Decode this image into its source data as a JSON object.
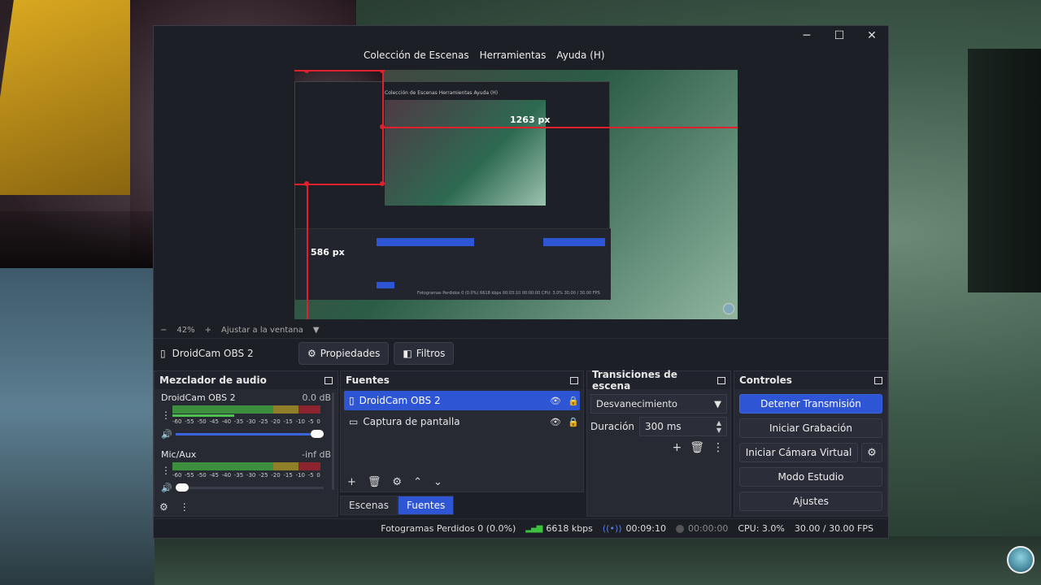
{
  "window": {
    "minimize": "─",
    "maximize": "☐",
    "close": "✕"
  },
  "menu": {
    "items": [
      "Colección de Escenas",
      "Herramientas",
      "Ayuda (H)"
    ]
  },
  "preview": {
    "measure_h": "1263 px",
    "measure_v": "586 px",
    "inner_menu": "Colección de Escenas   Herramientas   Ayuda (H)",
    "inner_status": "Fotogramas Perdidos 0 (0.0%)   6618 kbps   00:03:10   00:00:00   CPU: 3.0%   30.00 / 30.00 FPS"
  },
  "zoom": {
    "minus": "−",
    "level": "42%",
    "plus": "+",
    "fit": "Ajustar a la ventana",
    "arrow": "▼"
  },
  "source_bar": {
    "name": "DroidCam OBS 2",
    "properties": "Propiedades",
    "filters": "Filtros"
  },
  "mixer": {
    "title": "Mezclador de audio",
    "channels": [
      {
        "name": "DroidCam OBS 2",
        "db": "0.0 dB",
        "level": 0.42,
        "volume": 1.0
      },
      {
        "name": "Mic/Aux",
        "db": "-inf dB",
        "level": 0.0,
        "volume": 0.0
      }
    ],
    "ticks": [
      "-60",
      "-55",
      "-50",
      "-45",
      "-40",
      "-35",
      "-30",
      "-25",
      "-20",
      "-15",
      "-10",
      "-5",
      "0"
    ]
  },
  "sources": {
    "title": "Fuentes",
    "items": [
      {
        "name": "DroidCam OBS 2",
        "selected": true
      },
      {
        "name": "Captura de pantalla",
        "selected": false
      }
    ],
    "tabs": [
      "Escenas",
      "Fuentes"
    ]
  },
  "transitions": {
    "title": "Transiciones de escena",
    "selected": "Desvanecimiento",
    "duration_label": "Duración",
    "duration_value": "300 ms"
  },
  "controls": {
    "title": "Controles",
    "stop_stream": "Detener Transmisión",
    "start_record": "Iniciar Grabación",
    "virtual_cam": "Iniciar Cámara Virtual",
    "studio_mode": "Modo Estudio",
    "settings": "Ajustes"
  },
  "status": {
    "dropped": "Fotogramas Perdidos 0 (0.0%)",
    "bitrate": "6618 kbps",
    "stream_time": "00:09:10",
    "record_time": "00:00:00",
    "cpu": "CPU: 3.0%",
    "fps": "30.00 / 30.00 FPS"
  },
  "colors": {
    "accent": "#2e55d4",
    "panel": "#272a33",
    "window": "#1d1f26"
  }
}
